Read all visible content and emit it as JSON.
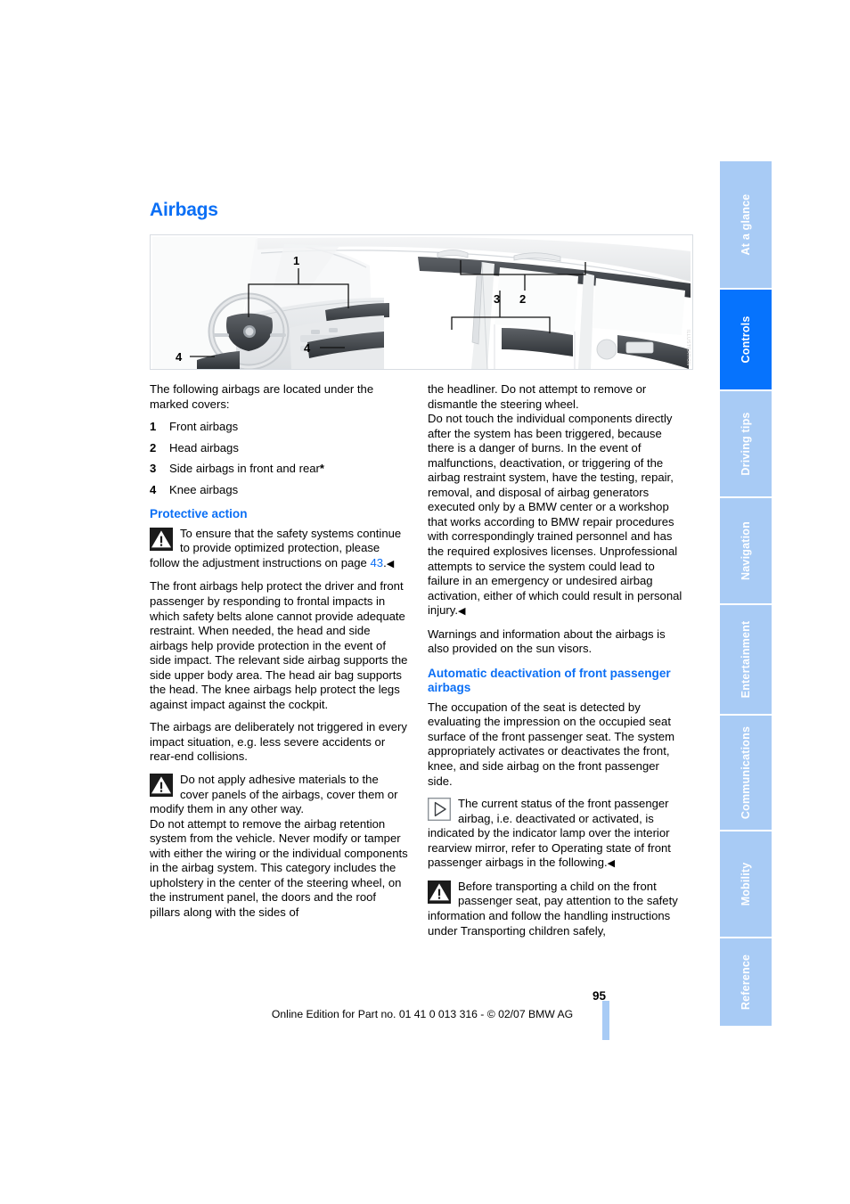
{
  "document": {
    "title": "Airbags",
    "page_number": "95",
    "footer": "Online Edition for Part no. 01 41 0 013 316 - © 02/07 BMW AG",
    "accent_blue": "#0b6ff5",
    "tab_active_blue": "#0673fd",
    "tab_inactive_blue": "#a8cbf5"
  },
  "tabs": [
    {
      "label": "At a glance",
      "active": false
    },
    {
      "label": "Controls",
      "active": true
    },
    {
      "label": "Driving tips",
      "active": false
    },
    {
      "label": "Navigation",
      "active": false
    },
    {
      "label": "Entertainment",
      "active": false
    },
    {
      "label": "Communications",
      "active": false
    },
    {
      "label": "Mobility",
      "active": false
    },
    {
      "label": "Reference",
      "active": false
    }
  ],
  "illustration": {
    "name": "car-interior-airbag-locations",
    "callouts": [
      "1",
      "2",
      "3",
      "4",
      "4"
    ],
    "credit": "ILLUSTRATION"
  },
  "left_column": {
    "intro": "The following airbags are located under the marked covers:",
    "list": [
      {
        "num": "1",
        "text": "Front airbags",
        "star": ""
      },
      {
        "num": "2",
        "text": "Head airbags",
        "star": ""
      },
      {
        "num": "3",
        "text": "Side airbags in front and rear",
        "star": "*"
      },
      {
        "num": "4",
        "text": "Knee airbags",
        "star": ""
      }
    ],
    "protective_action_heading": "Protective action",
    "warning1_pre": "To ensure that the safety systems continue to provide optimized protection, please follow the adjustment instructions on page ",
    "warning1_xref": "43",
    "warning1_post": ".",
    "para1": "The front airbags help protect the driver and front passenger by responding to frontal impacts in which safety belts alone cannot provide adequate restraint. When needed, the head and side airbags help provide protection in the event of side impact. The relevant side airbag supports the side upper body area. The head air bag supports the head. The knee airbags help protect the legs against impact against the cockpit.",
    "para2": "The airbags are deliberately not triggered in every impact situation, e.g. less severe accidents or rear-end collisions.",
    "warning2": "Do not apply adhesive materials to the cover panels of the airbags, cover them or modify them in any other way.",
    "para3": "Do not attempt to remove the airbag retention system from the vehicle. Never modify or tamper with either the wiring or the individual components in the airbag system. This category includes the upholstery in the center of the steering wheel, on the instrument panel, the doors and the roof pillars along with the sides of"
  },
  "right_column": {
    "para_continued": "the headliner. Do not attempt to remove or dismantle the steering wheel.",
    "para1": "Do not touch the individual components directly after the system has been triggered, because there is a danger of burns. In the event of malfunctions, deactivation, or triggering of the airbag restraint system, have the testing, repair, removal, and disposal of airbag generators executed only by a BMW center or a workshop that works according to BMW repair procedures with correspondingly trained personnel and has the required explosives licenses. Unprofessional attempts to service the system could lead to failure in an emergency or undesired airbag activation, either of which could result in personal injury.",
    "para2": "Warnings and information about the airbags is also provided on the sun visors.",
    "auto_deactivation_heading": "Automatic deactivation of front passenger airbags",
    "para3": "The occupation of the seat is detected by evaluating the impression on the occupied seat surface of the front passenger seat. The system appropriately activates or deactivates the front, knee, and side airbag on the front passenger side.",
    "note1": "The current status of the front passenger airbag, i.e. deactivated or activated, is indicated by the indicator lamp over the interior rearview mirror, refer to Operating state of front passenger airbags in the following.",
    "warning3": "Before transporting a child on the front passenger seat, pay attention to the safety information and follow the handling instructions under Transporting children safely,"
  },
  "symbols": {
    "end_mark": "◀",
    "warning_icon": "warning-triangle-icon",
    "note_icon": "note-arrow-icon"
  }
}
